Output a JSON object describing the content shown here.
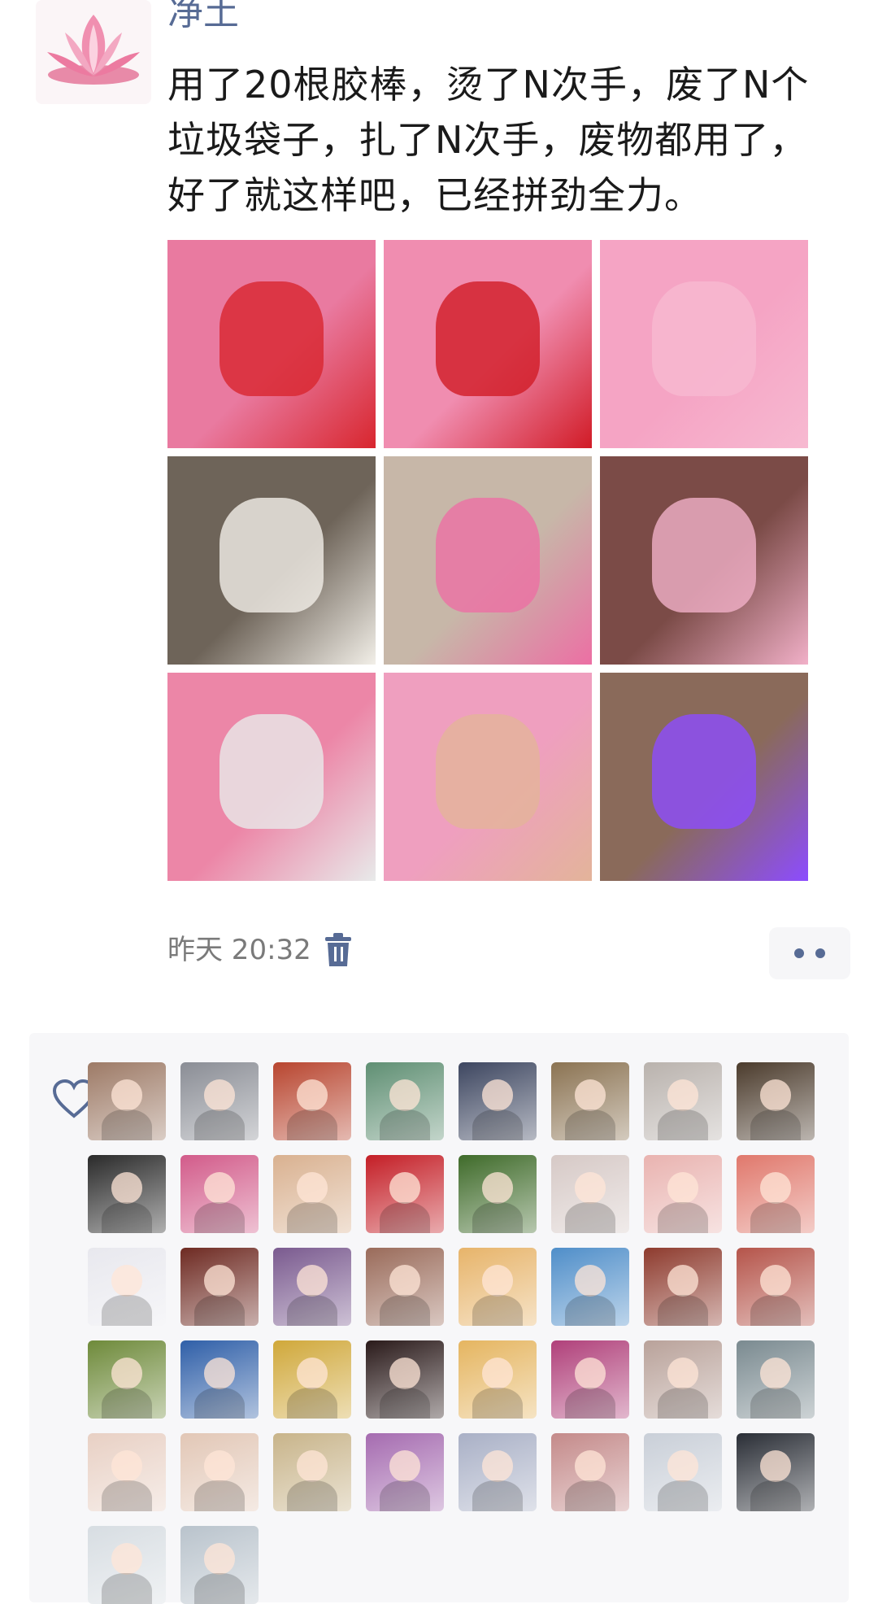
{
  "post": {
    "username": "净土",
    "text": "用了20根胶棒，烫了N次手，废了N个垃圾袋子，扎了N次手，废物都用了，好了就这样吧，已经拼劲全力。",
    "time": "昨天 20:32"
  },
  "photos": [
    {
      "name": "photo-paper-fan-bow",
      "bg": "#e97aa0",
      "accent": "#d8262e"
    },
    {
      "name": "photo-red-bow-cone",
      "bg": "#f08db0",
      "accent": "#d11b26"
    },
    {
      "name": "photo-pink-hat",
      "bg": "#f5a4c4",
      "accent": "#f7b9d1"
    },
    {
      "name": "photo-white-ruffle-lamp",
      "bg": "#6e6459",
      "accent": "#f2efe8"
    },
    {
      "name": "photo-girl-costume",
      "bg": "#c7b7a8",
      "accent": "#ec6fa4"
    },
    {
      "name": "photo-mother-daughter",
      "bg": "#7b4b47",
      "accent": "#f1b0c8"
    },
    {
      "name": "photo-glue-sticks",
      "bg": "#ec86a7",
      "accent": "#e8eaea"
    },
    {
      "name": "photo-finger-felt",
      "bg": "#ef9fbf",
      "accent": "#e3b49a"
    },
    {
      "name": "photo-lighted-costume",
      "bg": "#8a6a5a",
      "accent": "#8c4cff"
    }
  ],
  "liker_colors": [
    "#9d7a66",
    "#8a8d95",
    "#b8452f",
    "#5f8f73",
    "#3d4660",
    "#8b7352",
    "#b9b2ad",
    "#4b3b2c",
    "#2a2a2a",
    "#d25b8a",
    "#d9b190",
    "#c41e26",
    "#3f6b2a",
    "#d6c9c6",
    "#e9b3b0",
    "#e0786c",
    "#e8e8ee",
    "#6e2a22",
    "#7a5a8f",
    "#9a6b5a",
    "#e7b46a",
    "#4f8ec9",
    "#8e3b2e",
    "#b5544a",
    "#6e8a3a",
    "#2f5fa8",
    "#d0a83a",
    "#2a1a1a",
    "#e5b560",
    "#b0407a",
    "#b9a29a",
    "#7a8a90",
    "#e8d0c4",
    "#e2c7b6",
    "#c8b48a",
    "#a56bb0",
    "#a9b0c6",
    "#c48a8a",
    "#c9cfd8",
    "#2a2e36",
    "#d7dde2",
    "#b9c3cc"
  ]
}
